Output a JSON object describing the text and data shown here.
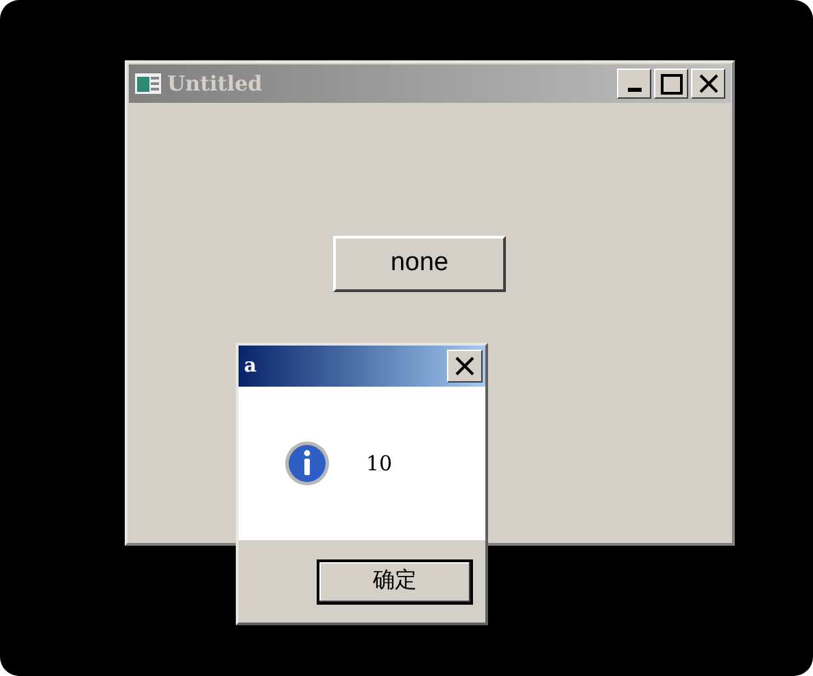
{
  "main_window": {
    "title": "Untitled",
    "button": "none"
  },
  "dialog": {
    "title": "a",
    "message": "10",
    "ok_button": "确定"
  }
}
